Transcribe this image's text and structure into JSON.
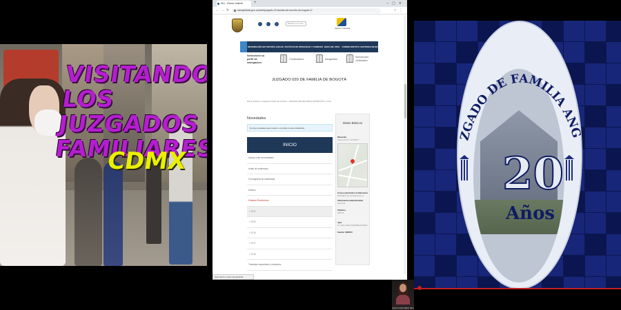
{
  "thumbnail": {
    "title": "VISITANDO\nLOS JUZGADOS\nFAMILIARES",
    "subtitle": "CDMX"
  },
  "browser": {
    "tab_title": "SIU - Rama Judicial",
    "url": "ramajudicial.gov.co/web/juzgado-20-familia-del-circuito-de-bogota-2/",
    "status_text": "Esperando a www.ramajudicial..."
  },
  "site": {
    "search_placeholder": "Buscar en el sitio",
    "right_logo_text": "Gobierno Colombia",
    "nav_items": [
      "INFORMACIÓN GENERAL",
      "VER MÁS JUZGADOS",
      "POLÍTICAS DE PRIVACIDAD Y CONDICIONES DE USO",
      "MAPA DEL SITIO",
      "CORREO INSTITUCIONAL",
      "HISTÓRICO DE NOTICIAS"
    ],
    "profile_label": "Seleccione su perfil de navegacion",
    "profiles": [
      "Ciudadanos",
      "Abogados",
      "Servidores Judiciales"
    ],
    "page_title": "JUZGADO 020 DE FAMILIA DE BOGOTÁ",
    "breadcrumb": "Rama Judicial  »  Juzgados Familia del Circuito  »  JUZGADO 020 DE FAMILIA DE BOGOTÁ  »  Inicio",
    "novedades_title": "Novedades",
    "novedades_alert": "No hay novedades para mostrar o el portlet no está configurado.",
    "inicio_label": "INICIO",
    "menu": [
      {
        "label": "Avisos a las comunidades",
        "style": ""
      },
      {
        "label": "Actas de audiencias",
        "style": ""
      },
      {
        "label": "Cronograma de audiencias",
        "style": ""
      },
      {
        "label": "Edictos",
        "style": ""
      },
      {
        "label": "Estados Electrónicos",
        "style": "active"
      },
      {
        "label": "» 2021",
        "style": "sub hl"
      },
      {
        "label": "» 2020",
        "style": "sub"
      },
      {
        "label": "» 2019",
        "style": "sub"
      },
      {
        "label": "» 2017",
        "style": "sub"
      },
      {
        "label": "» 2016",
        "style": "sub"
      },
      {
        "label": "Traslados especiales y ordinarios",
        "style": ""
      }
    ],
    "sidebar": {
      "title": "Datos Básicos",
      "direccion_label": "Dirección",
      "direccion_value": "CALLE 12C No. 7-36 PISO 6",
      "email_label": "Correo electrónico institucional",
      "email_value": "flia20bt@cendoj.ramajudicial.gov.co",
      "info_label": "Información administrativa",
      "info_value": "Presencial",
      "tel_label": "Teléfono",
      "tel_value": "2841173",
      "juez_label": "Juez",
      "juez_value": "Dr. JUAN CARLOS RAMIREZ RODRIGUEZ",
      "fuente_label": "Fuente: SIERJU"
    }
  },
  "webcam": {
    "name": "Antonio Carlos Bañón Sánchez"
  },
  "seal": {
    "arc_text": "JUZGADO DE FAMILIA ANGOL",
    "number": "20",
    "years": "Años"
  },
  "colors": {
    "thumb_title": "#b51ed0",
    "thumb_subtitle": "#e8f000",
    "nav_bg": "#1f3858",
    "seal_blue": "#0f1c63",
    "alert_red": "#c0392b"
  }
}
